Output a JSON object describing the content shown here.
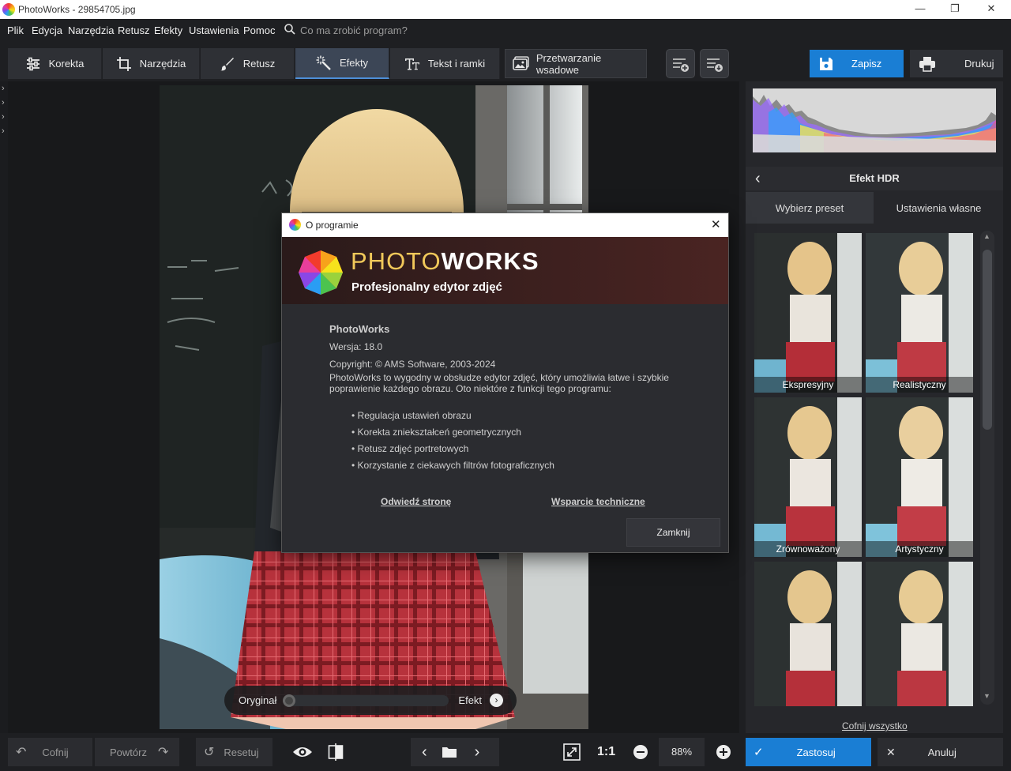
{
  "window": {
    "title": "PhotoWorks - 29854705.jpg",
    "minimize": "—",
    "maximize": "❐",
    "close": "✕"
  },
  "menu": {
    "items": [
      "Plik",
      "Edycja",
      "Narzędzia",
      "Retusz",
      "Efekty",
      "Ustawienia",
      "Pomoc"
    ],
    "search_placeholder": "Co ma zrobić program?"
  },
  "toolbar": {
    "tabs": [
      "Korekta",
      "Narzędzia",
      "Retusz",
      "Efekty",
      "Tekst i ramki"
    ],
    "active_tab": "Efekty",
    "batch": "Przetwarzanie wsadowe",
    "save": "Zapisz",
    "print": "Drukuj"
  },
  "compare": {
    "original": "Oryginał",
    "effect": "Efekt"
  },
  "panel": {
    "title": "Efekt HDR",
    "tab_presets": "Wybierz preset",
    "tab_custom": "Ustawienia własne",
    "presets": [
      "Ekspresyjny",
      "Realistyczny",
      "Zrównoważony",
      "Artystyczny",
      "",
      ""
    ],
    "reset_all": "Cofnij wszystko"
  },
  "bottom": {
    "undo": "Cofnij",
    "redo": "Powtórz",
    "reset": "Resetuj",
    "one_to_one": "1:1",
    "zoom": "88%",
    "apply": "Zastosuj",
    "cancel": "Anuluj"
  },
  "dialog": {
    "title": "O programie",
    "brand_photo": "PHOTO",
    "brand_works": "WORKS",
    "tagline": "Profesjonalny edytor zdjęć",
    "app_name": "PhotoWorks",
    "version": "Wersja: 18.0",
    "copyright": "Copyright: © AMS Software, 2003-2024",
    "description": "PhotoWorks to wygodny w obsłudze edytor zdjęć, który umożliwia łatwe i szybkie poprawienie każdego obrazu. Oto niektóre z funkcji tego programu:",
    "features": [
      "• Regulacja ustawień obrazu",
      "• Korekta zniekształceń geometrycznych",
      "• Retusz zdjęć portretowych",
      "• Korzystanie z ciekawych filtrów fotograficznych"
    ],
    "link_site": "Odwiedź stronę",
    "link_support": "Wsparcie techniczne",
    "close_button": "Zamknij"
  },
  "colors": {
    "accent": "#1a7ed4",
    "background": "#1e1f22",
    "panel": "#26272b"
  }
}
